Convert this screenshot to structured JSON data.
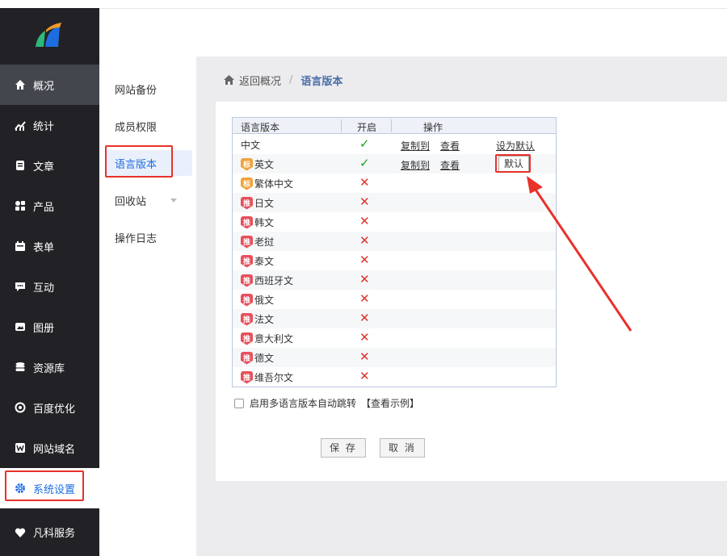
{
  "colors": {
    "sidebar_bg": "#222226",
    "accent_blue": "#1e6de0",
    "highlight_red": "#e8322a",
    "check_green": "#1ea01e",
    "cross_red": "#e0312b"
  },
  "sidebar": {
    "logo": "logo-icon",
    "items": [
      {
        "label": "概况",
        "icon": "home-icon"
      },
      {
        "label": "统计",
        "icon": "chart-icon"
      },
      {
        "label": "文章",
        "icon": "article-icon"
      },
      {
        "label": "产品",
        "icon": "grid-icon"
      },
      {
        "label": "表单",
        "icon": "calendar-icon"
      },
      {
        "label": "互动",
        "icon": "chat-icon"
      },
      {
        "label": "图册",
        "icon": "image-icon"
      },
      {
        "label": "资源库",
        "icon": "database-icon"
      },
      {
        "label": "百度优化",
        "icon": "target-icon"
      },
      {
        "label": "网站域名",
        "icon": "w-icon"
      },
      {
        "label": "系统设置",
        "icon": "gear-icon"
      },
      {
        "label": "凡科服务",
        "icon": "heart-icon"
      }
    ]
  },
  "submenu": {
    "items": [
      {
        "label": "网站备份"
      },
      {
        "label": "成员权限"
      },
      {
        "label": "语言版本"
      },
      {
        "label": "回收站"
      },
      {
        "label": "操作日志"
      }
    ]
  },
  "breadcrumb": {
    "home_icon": "home-icon",
    "back": "返回概况",
    "separator": "/",
    "current": "语言版本"
  },
  "language_table": {
    "headers": {
      "name": "语言版本",
      "enabled": "开启",
      "actions": "操作"
    },
    "rows": [
      {
        "name": "中文",
        "badge": "",
        "enabled": "✓",
        "copy": "复制到",
        "view": "查看",
        "default": "设为默认"
      },
      {
        "name": "英文",
        "badge": "标",
        "enabled": "✓",
        "copy": "复制到",
        "view": "查看",
        "default": "默认"
      },
      {
        "name": "繁体中文",
        "badge": "标",
        "enabled": "✕"
      },
      {
        "name": "日文",
        "badge": "推",
        "enabled": "✕"
      },
      {
        "name": "韩文",
        "badge": "推",
        "enabled": "✕"
      },
      {
        "name": "老挝",
        "badge": "推",
        "enabled": "✕"
      },
      {
        "name": "泰文",
        "badge": "推",
        "enabled": "✕"
      },
      {
        "name": "西班牙文",
        "badge": "推",
        "enabled": "✕"
      },
      {
        "name": "俄文",
        "badge": "推",
        "enabled": "✕"
      },
      {
        "name": "法文",
        "badge": "推",
        "enabled": "✕"
      },
      {
        "name": "意大利文",
        "badge": "推",
        "enabled": "✕"
      },
      {
        "name": "德文",
        "badge": "推",
        "enabled": "✕"
      },
      {
        "name": "维吾尔文",
        "badge": "推",
        "enabled": "✕"
      }
    ]
  },
  "options": {
    "auto_redirect": "启用多语言版本自动跳转",
    "example_link": "【查看示例】"
  },
  "buttons": {
    "save": "保 存",
    "cancel": "取 消"
  }
}
